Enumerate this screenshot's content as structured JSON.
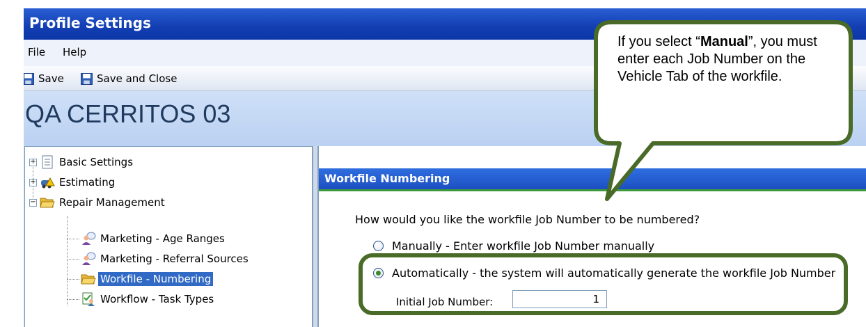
{
  "window": {
    "title": "Profile Settings"
  },
  "menu": {
    "file": "File",
    "help": "Help"
  },
  "toolbar": {
    "save": "Save",
    "save_close": "Save and Close"
  },
  "profile_name": "QA CERRITOS 03",
  "tree": {
    "basic_settings": "Basic Settings",
    "estimating": "Estimating",
    "repair_management": "Repair Management",
    "age_ranges": "Marketing - Age Ranges",
    "referral_sources": "Marketing - Referral Sources",
    "workfile_numbering": "Workfile - Numbering",
    "task_types": "Workflow - Task Types"
  },
  "panel": {
    "header": "Workfile Numbering",
    "question": "How would you like the workfile Job Number to be numbered?",
    "option_manual": "Manually - Enter workfile Job Number manually",
    "option_auto": "Automatically - the system will automatically generate the workfile Job Number",
    "selected_option": "Automatically",
    "initial_label": "Initial Job Number:",
    "initial_value": "1"
  },
  "callout": {
    "pre": "If you select “",
    "bold": "Manual",
    "post": "”, you must enter each Job Number on the Vehicle Tab of the workfile."
  },
  "colors": {
    "titlebar": "#1440b4",
    "section_header": "#1d4fc2",
    "callout_border": "#4a6b27",
    "selection": "#316ac5"
  }
}
